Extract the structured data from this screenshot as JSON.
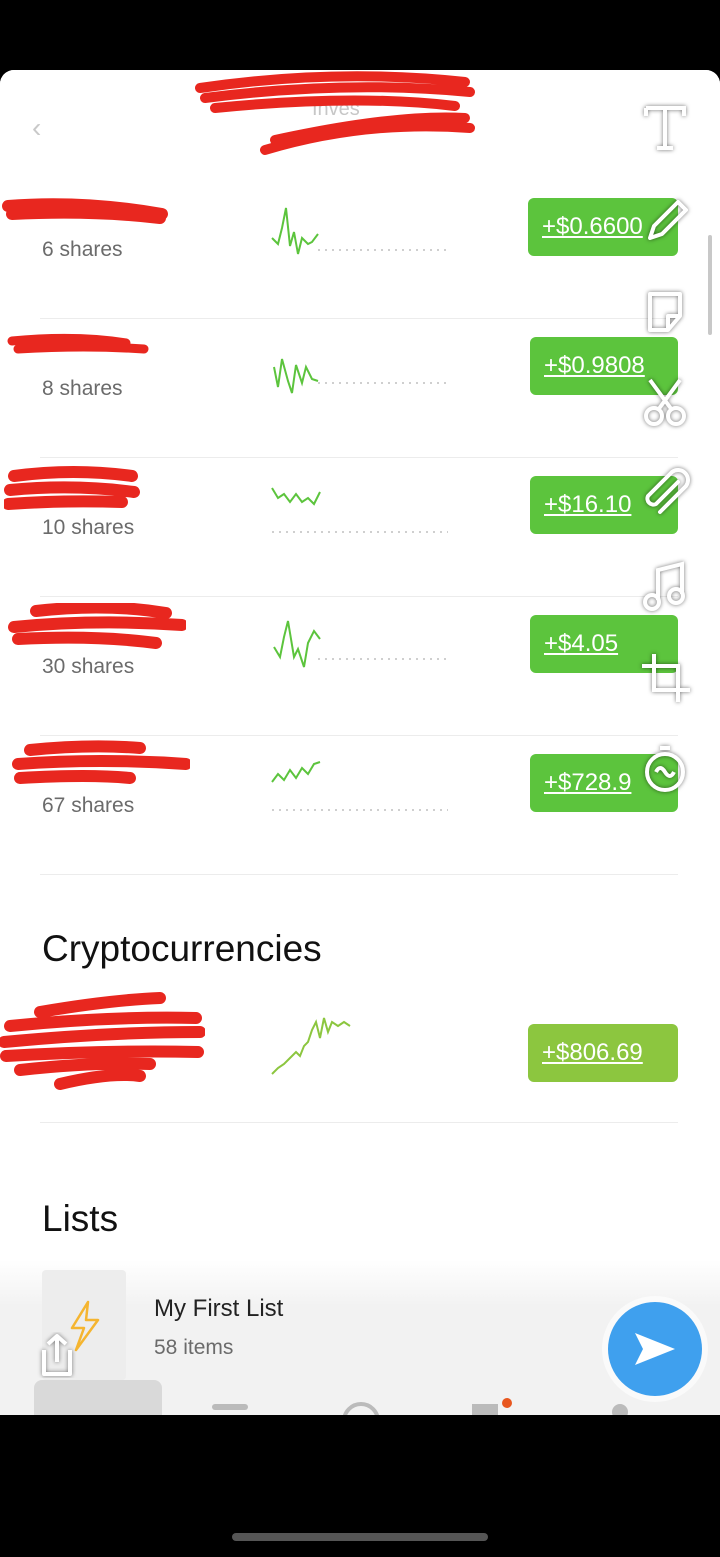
{
  "header": {
    "back_icon": "chevron-left-icon",
    "title": "",
    "subtitle": "Inves"
  },
  "colors": {
    "gain_green": "#5cc43d",
    "crypto_green": "#8cc63f",
    "redaction_red": "#e8271f",
    "send_blue": "#3fa0ee"
  },
  "stocks": [
    {
      "shares": "6 shares",
      "value": "+$0.6600"
    },
    {
      "shares": "8 shares",
      "value": "+$0.9808"
    },
    {
      "shares": "10 shares",
      "value": "+$16.10"
    },
    {
      "shares": "30 shares",
      "value": "+$4.05"
    },
    {
      "shares": "67 shares",
      "value": "+$728.9"
    }
  ],
  "crypto": {
    "section_title": "Cryptocurrencies",
    "value": "+$806.69"
  },
  "lists": {
    "section_title": "Lists",
    "items": [
      {
        "name": "My First List",
        "count": "58 items",
        "icon": "lightning-icon"
      }
    ]
  },
  "editor_tools": [
    "text-icon",
    "pencil-icon",
    "sticker-icon",
    "scissors-icon",
    "paperclip-icon",
    "music-icon",
    "crop-icon",
    "timer-icon"
  ],
  "send_icon": "send-icon",
  "share_icon": "share-icon"
}
